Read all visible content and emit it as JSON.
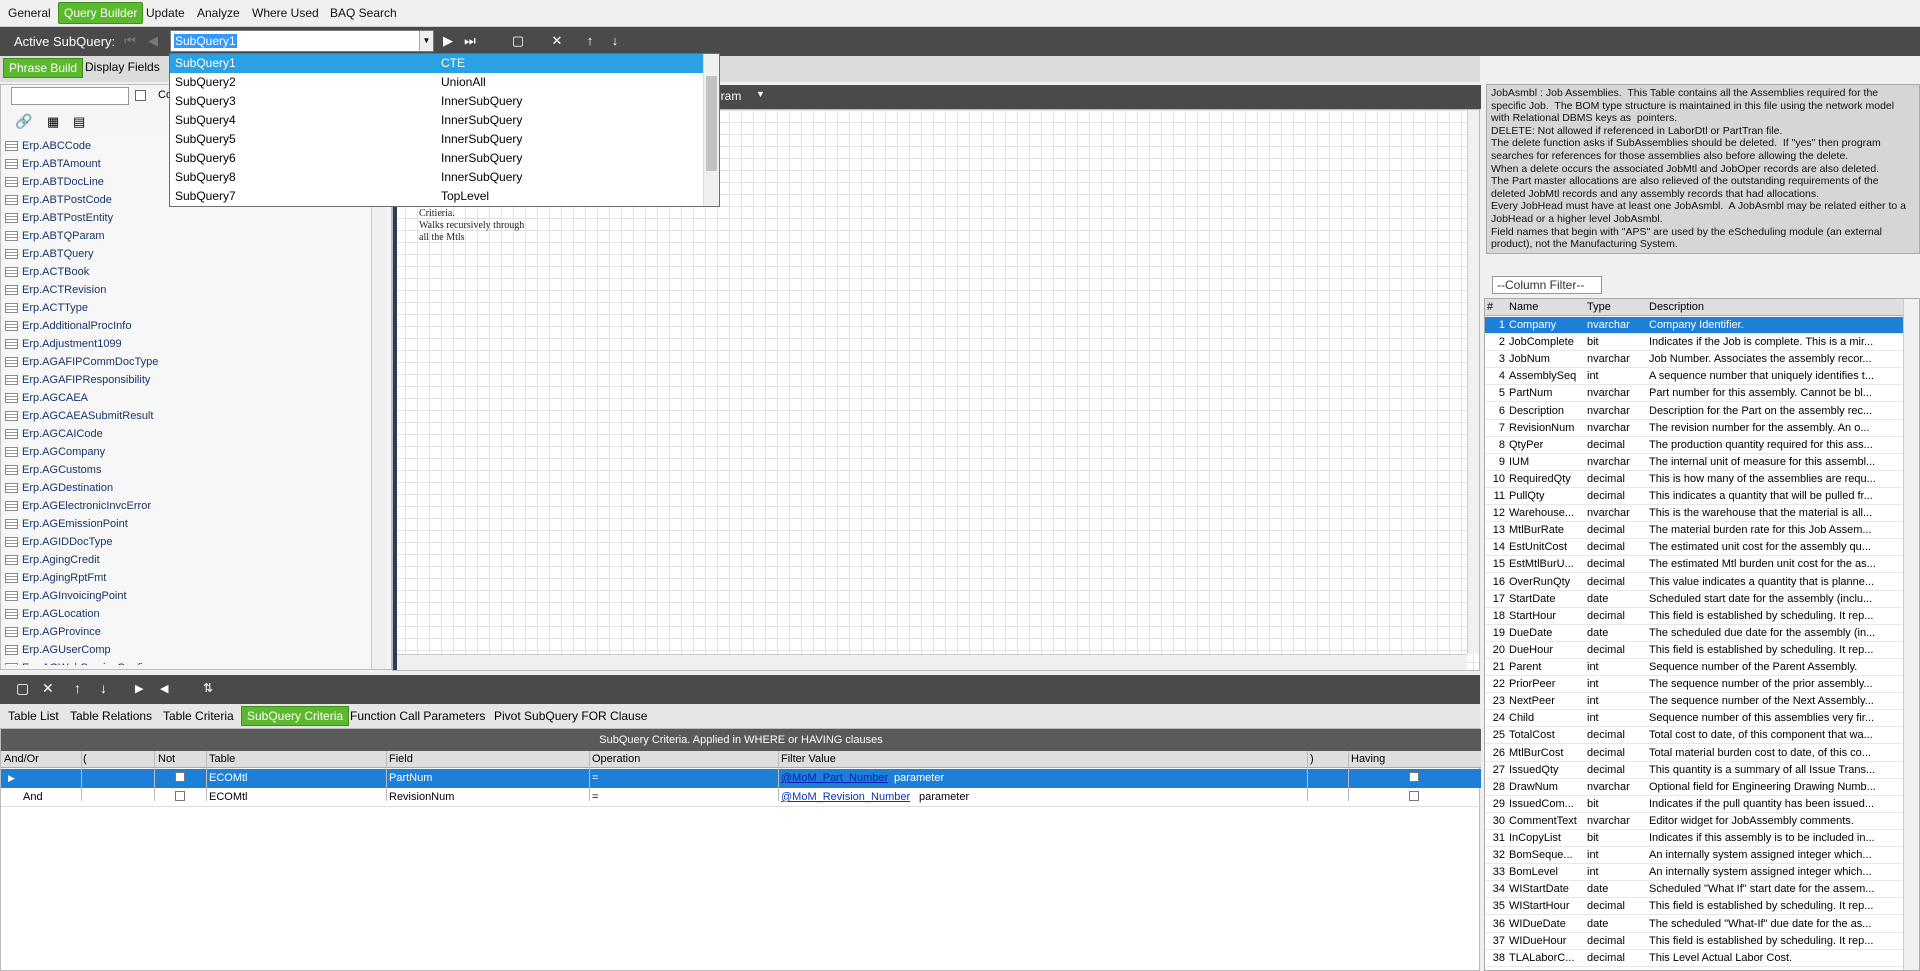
{
  "menubar": {
    "items": [
      "General",
      "Query Builder",
      "Update",
      "Analyze",
      "Where Used",
      "BAQ Search"
    ]
  },
  "subquery_bar": {
    "label": "Active SubQuery:",
    "combo_value": "SubQuery1"
  },
  "dropdown": {
    "rows": [
      {
        "name": "SubQuery1",
        "type": "CTE"
      },
      {
        "name": "SubQuery2",
        "type": "UnionAll"
      },
      {
        "name": "SubQuery3",
        "type": "InnerSubQuery"
      },
      {
        "name": "SubQuery4",
        "type": "InnerSubQuery"
      },
      {
        "name": "SubQuery5",
        "type": "InnerSubQuery"
      },
      {
        "name": "SubQuery6",
        "type": "InnerSubQuery"
      },
      {
        "name": "SubQuery8",
        "type": "InnerSubQuery"
      },
      {
        "name": "SubQuery7",
        "type": "TopLevel"
      }
    ]
  },
  "phrase_tabs": [
    "Phrase Build",
    "Display Fields"
  ],
  "left_fragment": "Co",
  "canvas_header_fragment": "gram",
  "canvas_note": [
    "Critieria.",
    "Walks recursively through",
    "all the Mtls"
  ],
  "tables": [
    "Erp.ABCCode",
    "Erp.ABTAmount",
    "Erp.ABTDocLine",
    "Erp.ABTPostCode",
    "Erp.ABTPostEntity",
    "Erp.ABTQParam",
    "Erp.ABTQuery",
    "Erp.ACTBook",
    "Erp.ACTRevision",
    "Erp.ACTType",
    "Erp.AdditionalProcInfo",
    "Erp.Adjustment1099",
    "Erp.AGAFIPCommDocType",
    "Erp.AGAFIPResponsibility",
    "Erp.AGCAEA",
    "Erp.AGCAEASubmitResult",
    "Erp.AGCAICode",
    "Erp.AGCompany",
    "Erp.AGCustoms",
    "Erp.AGDestination",
    "Erp.AGElectronicInvcError",
    "Erp.AGEmissionPoint",
    "Erp.AGIDDocType",
    "Erp.AgingCredit",
    "Erp.AgingRptFmt",
    "Erp.AGInvoicingPoint",
    "Erp.AGLocation",
    "Erp.AGProvince",
    "Erp.AGUserComp",
    "Erp.AGWebServiceConfig"
  ],
  "bottom_tabs": [
    "Table List",
    "Table Relations",
    "Table Criteria",
    "SubQuery Criteria",
    "Function Call Parameters",
    "Pivot SubQuery FOR Clause"
  ],
  "criteria": {
    "caption": "SubQuery Criteria. Applied in WHERE or HAVING clauses",
    "headers": [
      "And/Or",
      "(",
      "Not",
      "Table",
      "Field",
      "Operation",
      "Filter Value",
      ")",
      "Having"
    ],
    "rows": [
      {
        "andor": "",
        "table": "ECOMtl",
        "field": "PartNum",
        "op": "=",
        "value": "@MoM_Part_Number",
        "suffix": "parameter"
      },
      {
        "andor": "And",
        "table": "ECOMtl",
        "field": "RevisionNum",
        "op": "=",
        "value": "@MoM_Revision_Number",
        "suffix": "parameter"
      }
    ]
  },
  "description": "JobAsmbl : Job Assemblies.  This Table contains all the Assemblies required for the specific Job.  The BOM type structure is maintained in this file using the network model with Relational DBMS keys as  pointers.\nDELETE: Not allowed if referenced in LaborDtl or PartTran file.\nThe delete function asks if SubAssemblies should be deleted.  If \"yes\" then program searches for references for those assemblies also before allowing the delete.\nWhen a delete occurs the associated JobMtl and JobOper records are also deleted.\nThe Part master allocations are also relieved of the outstanding requirements of the deleted JobMtl records and any assembly records that had allocations.\nEvery JobHead must have at least one JobAsmbl.  A JobAsmbl may be related either to a JobHead or a higher level JobAsmbl.\nField names that begin with \"APS\" are used by the eScheduling module (an external product), not the Manufacturing System.",
  "column_filter": "--Column Filter--",
  "fields_header": [
    "#",
    "Name",
    "Type",
    "Description"
  ],
  "fields": [
    [
      "1",
      "Company",
      "nvarchar",
      "Company Identifier."
    ],
    [
      "2",
      "JobComplete",
      "bit",
      "Indicates if the Job is complete.  This is a mir..."
    ],
    [
      "3",
      "JobNum",
      "nvarchar",
      "Job Number.  Associates the assembly recor..."
    ],
    [
      "4",
      "AssemblySeq",
      "int",
      "A sequence number that uniquely identifies t..."
    ],
    [
      "5",
      "PartNum",
      "nvarchar",
      "Part number for this assembly.  Cannot be bl..."
    ],
    [
      "6",
      "Description",
      "nvarchar",
      "Description for the Part on the assembly rec..."
    ],
    [
      "7",
      "RevisionNum",
      "nvarchar",
      "The revision number for the assembly.  An o..."
    ],
    [
      "8",
      "QtyPer",
      "decimal",
      "The production quantity required for this ass..."
    ],
    [
      "9",
      "IUM",
      "nvarchar",
      "The internal unit of measure for this assembl..."
    ],
    [
      "10",
      "RequiredQty",
      "decimal",
      "This is how many of the assemblies are requ..."
    ],
    [
      "11",
      "PullQty",
      "decimal",
      "This indicates a quantity that will be pulled fr..."
    ],
    [
      "12",
      "Warehouse...",
      "nvarchar",
      "This is the warehouse that the material is all..."
    ],
    [
      "13",
      "MtlBurRate",
      "decimal",
      "The material burden rate for this Job Assem..."
    ],
    [
      "14",
      "EstUnitCost",
      "decimal",
      "The estimated unit cost for the assembly qu..."
    ],
    [
      "15",
      "EstMtlBurU...",
      "decimal",
      "The estimated Mtl burden unit cost for the as..."
    ],
    [
      "16",
      "OverRunQty",
      "decimal",
      "This value indicates a quantity that is planne..."
    ],
    [
      "17",
      "StartDate",
      "date",
      "Scheduled start date for the assembly (inclu..."
    ],
    [
      "18",
      "StartHour",
      "decimal",
      "This field is established by scheduling.  It rep..."
    ],
    [
      "19",
      "DueDate",
      "date",
      "The scheduled due date for the assembly (in..."
    ],
    [
      "20",
      "DueHour",
      "decimal",
      "This field is established by scheduling.  It rep..."
    ],
    [
      "21",
      "Parent",
      "int",
      "Sequence number of the Parent Assembly."
    ],
    [
      "22",
      "PriorPeer",
      "int",
      "The  sequence number of the prior assembly..."
    ],
    [
      "23",
      "NextPeer",
      "int",
      "The sequence number of the Next Assembly..."
    ],
    [
      "24",
      "Child",
      "int",
      "Sequence number of this assemblies very fir..."
    ],
    [
      "25",
      "TotalCost",
      "decimal",
      "Total cost to date, of this component that wa..."
    ],
    [
      "26",
      "MtlBurCost",
      "decimal",
      "Total material burden cost to date, of this co..."
    ],
    [
      "27",
      "IssuedQty",
      "decimal",
      "This quantity is a summary of all Issue Trans..."
    ],
    [
      "28",
      "DrawNum",
      "nvarchar",
      "Optional field for Engineering Drawing Numb..."
    ],
    [
      "29",
      "IssuedCom...",
      "bit",
      "Indicates if the pull quantity has been issued..."
    ],
    [
      "30",
      "CommentText",
      "nvarchar",
      "Editor widget for JobAssembly comments."
    ],
    [
      "31",
      "InCopyList",
      "bit",
      "Indicates if this assembly is to be included in..."
    ],
    [
      "32",
      "BomSeque...",
      "int",
      "An internally system assigned integer which..."
    ],
    [
      "33",
      "BomLevel",
      "int",
      "An internally system assigned integer which..."
    ],
    [
      "34",
      "WIStartDate",
      "date",
      "Scheduled \"What If\" start date for the assem..."
    ],
    [
      "35",
      "WIStartHour",
      "decimal",
      "This field is established by scheduling.  It rep..."
    ],
    [
      "36",
      "WIDueDate",
      "date",
      "The scheduled \"What-If\" due date for the as..."
    ],
    [
      "37",
      "WIDueHour",
      "decimal",
      "This field is established by scheduling.  It rep..."
    ],
    [
      "38",
      "TLALaborC...",
      "decimal",
      "This Level Actual Labor Cost."
    ]
  ]
}
